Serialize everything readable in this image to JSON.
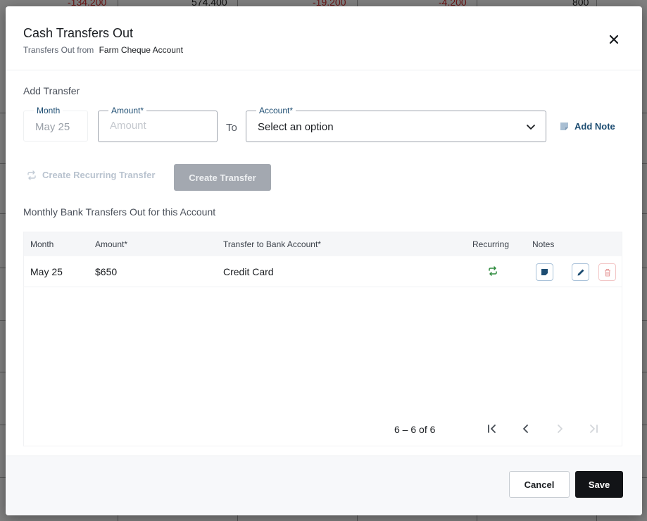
{
  "background": {
    "row_values": [
      "-134.200",
      "574.400",
      "-19.200",
      "-4.200",
      "800"
    ]
  },
  "modal": {
    "title": "Cash Transfers Out",
    "subtitle_prefix": "Transfers Out from",
    "subtitle_account": "Farm Cheque Account",
    "close_icon": "close-icon"
  },
  "add_transfer": {
    "section_label": "Add Transfer",
    "month_label": "Month",
    "month_value": "May 25",
    "amount_label": "Amount",
    "amount_required": "*",
    "amount_placeholder": "Amount",
    "to_label": "To",
    "account_label": "Account",
    "account_required": "*",
    "account_value": "Select an option",
    "add_note_label": "Add Note",
    "recurring_label": "Create Recurring Transfer",
    "create_label": "Create Transfer"
  },
  "table": {
    "section_label": "Monthly Bank Transfers Out for this Account",
    "headers": {
      "month": "Month",
      "amount": "Amount*",
      "account": "Transfer to Bank Account*",
      "recurring": "Recurring",
      "notes": "Notes"
    },
    "rows": [
      {
        "month": "May 25",
        "amount": "$650",
        "account": "Credit Card",
        "recurring": true
      }
    ],
    "pagination": "6 – 6 of 6"
  },
  "footer": {
    "cancel_label": "Cancel",
    "save_label": "Save"
  },
  "colors": {
    "accent": "#1d4d72",
    "recurring_green": "#2e8b3e",
    "delete_red": "#e8a0a0",
    "save_bg": "#121417"
  }
}
